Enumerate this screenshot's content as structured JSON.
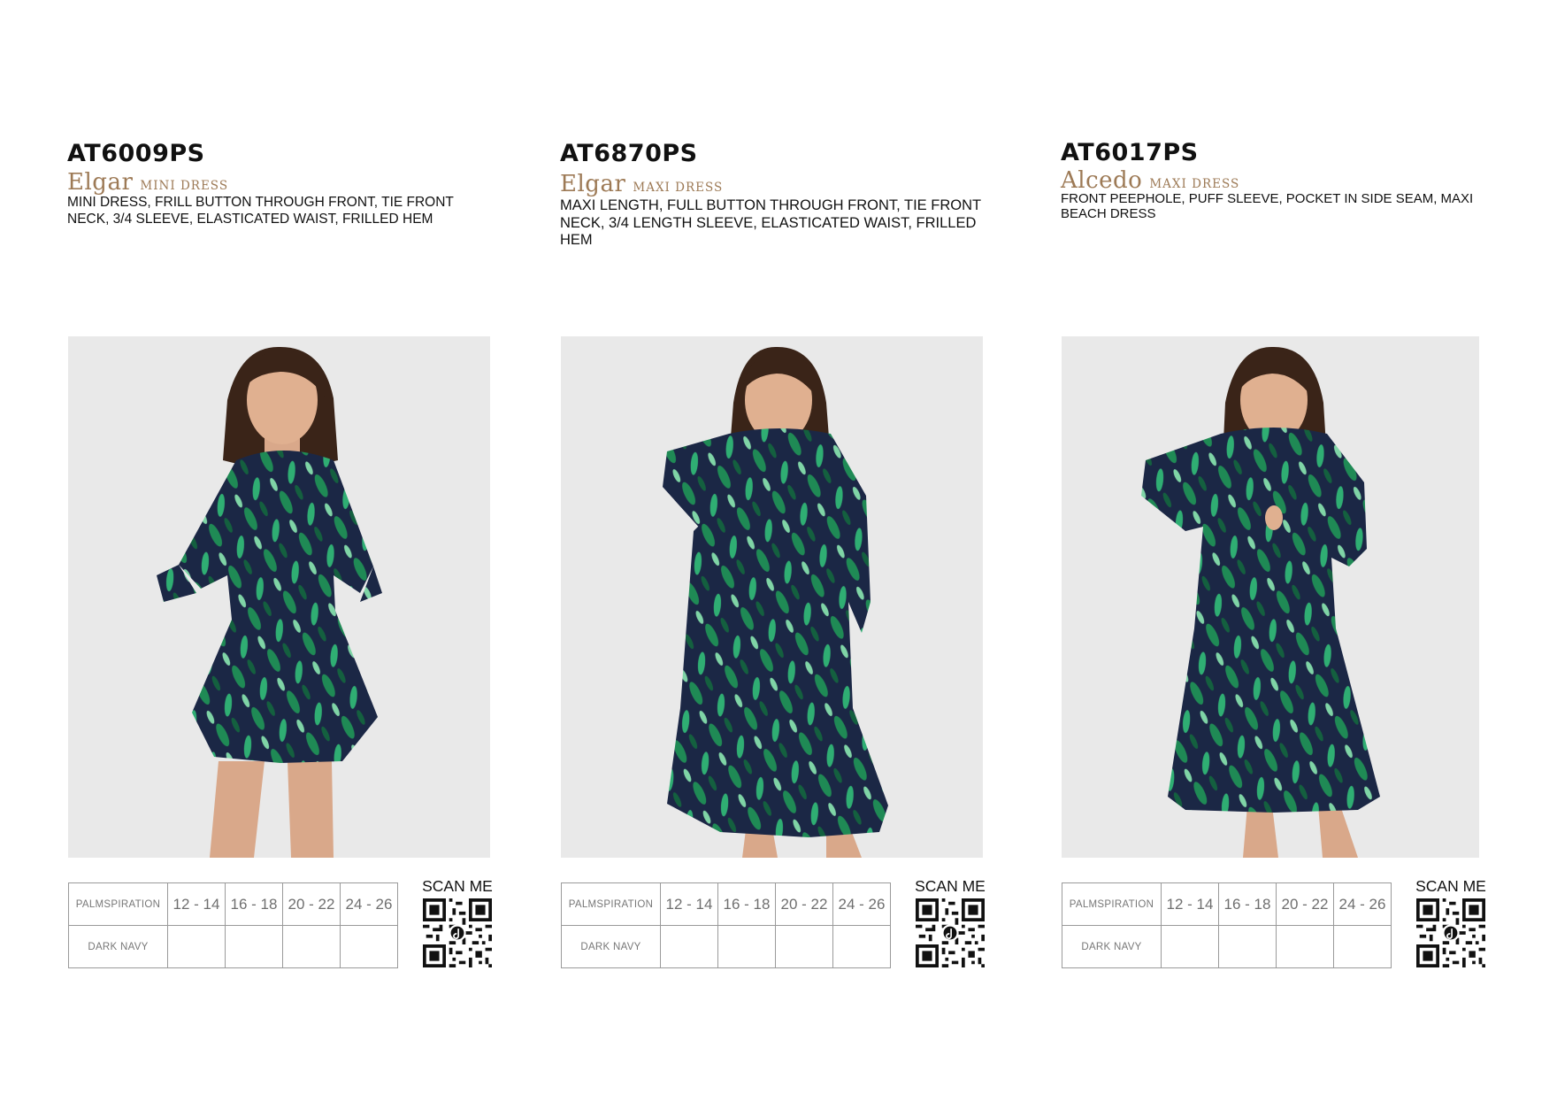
{
  "products": [
    {
      "code": "AT6009PS",
      "name": "Elgar",
      "type": "MINI DRESS",
      "description": "MINI DRESS, FRILL BUTTON THROUGH FRONT, TIE FRONT NECK, 3/4 SLEEVE, ELASTICATED WAIST, FRILLED HEM",
      "print_name": "PALMSPIRATION",
      "colour": "DARK NAVY",
      "sizes": [
        "12 - 14",
        "16 - 18",
        "20 - 22",
        "24 - 26"
      ],
      "scan_label": "SCAN ME"
    },
    {
      "code": "AT6870PS",
      "name": "Elgar",
      "type": "MAXI DRESS",
      "description": "MAXI LENGTH, FULL BUTTON THROUGH FRONT, TIE FRONT NECK, 3/4 LENGTH SLEEVE, ELASTICATED WAIST, FRILLED HEM",
      "print_name": "PALMSPIRATION",
      "colour": "DARK NAVY",
      "sizes": [
        "12 - 14",
        "16 - 18",
        "20 - 22",
        "24 - 26"
      ],
      "scan_label": "SCAN ME"
    },
    {
      "code": "AT6017PS",
      "name": "Alcedo",
      "type": "MAXI DRESS",
      "description": "FRONT PEEPHOLE, PUFF SLEEVE, POCKET IN SIDE SEAM, MAXI BEACH DRESS",
      "print_name": "PALMSPIRATION",
      "colour": "DARK NAVY",
      "sizes": [
        "12 - 14",
        "16 - 18",
        "20 - 22",
        "24 - 26"
      ],
      "scan_label": "SCAN ME"
    }
  ],
  "colors": {
    "name_accent": "#9d7a56",
    "photo_background": "#e9e9e9",
    "dress_navy": "#1b2745",
    "leaf_green": "#1f8a55",
    "table_border": "#9a9a9a"
  }
}
